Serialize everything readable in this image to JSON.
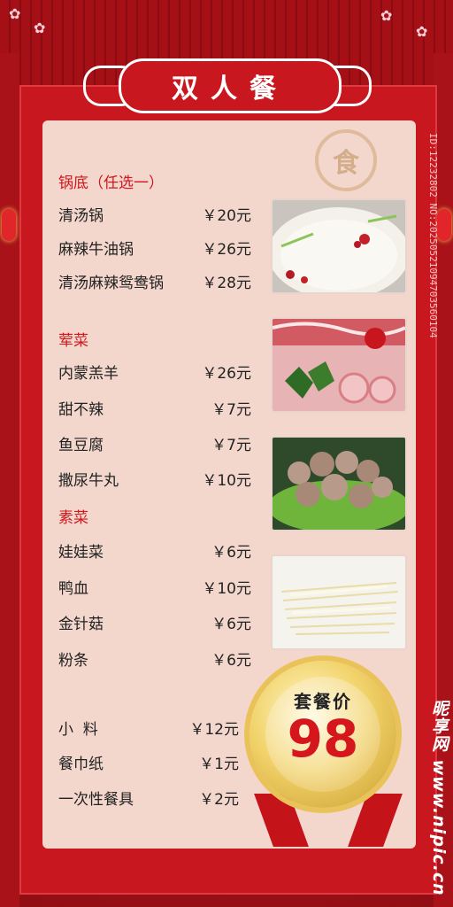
{
  "title": "双人餐",
  "seal_char": "食",
  "sections": {
    "soup": {
      "label": "锅底（任选一）",
      "items": [
        {
          "name": "清汤锅",
          "price": "￥20元"
        },
        {
          "name": "麻辣牛油锅",
          "price": "￥26元"
        },
        {
          "name": "清汤麻辣鸳鸯锅",
          "price": "￥28元"
        }
      ]
    },
    "meat": {
      "label": "荤菜",
      "items": [
        {
          "name": "内蒙羔羊",
          "price": "￥26元"
        },
        {
          "name": "甜不辣",
          "price": "￥7元"
        },
        {
          "name": "鱼豆腐",
          "price": "￥7元"
        },
        {
          "name": "撒尿牛丸",
          "price": "￥10元"
        }
      ]
    },
    "veg": {
      "label": "素菜",
      "items": [
        {
          "name": "娃娃菜",
          "price": "￥6元"
        },
        {
          "name": "鸭血",
          "price": "￥10元"
        },
        {
          "name": "金针菇",
          "price": "￥6元"
        },
        {
          "name": "粉条",
          "price": "￥6元"
        }
      ]
    },
    "extras": {
      "items": [
        {
          "name": "小  料",
          "price": "￥12元"
        },
        {
          "name": "餐巾纸",
          "price": "￥1元"
        },
        {
          "name": "一次性餐具",
          "price": "￥2元"
        }
      ]
    }
  },
  "badge": {
    "label": "套餐价",
    "price": "98"
  },
  "watermark": {
    "id": "ID:12232802 NO:20250521094703560104",
    "site": "昵享网 www.nipic.cn"
  },
  "colors": {
    "accent_red": "#d2161c",
    "panel": "#f3d7cd",
    "gold": "#e9c35a"
  }
}
